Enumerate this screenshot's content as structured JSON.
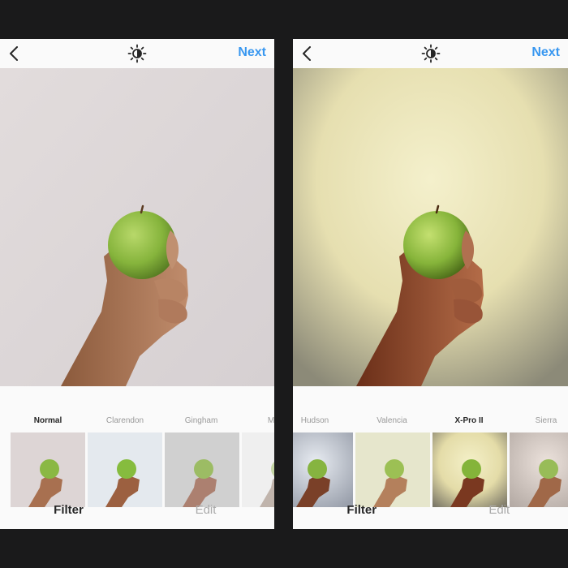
{
  "screens": [
    {
      "id": "left",
      "header": {
        "next_label": "Next",
        "back_icon": "chevron-left-icon",
        "adjust_icon": "lux-sun-icon"
      },
      "photo_filter": "Normal",
      "filters": [
        {
          "label": "Normal",
          "selected": true
        },
        {
          "label": "Clarendon",
          "selected": false
        },
        {
          "label": "Gingham",
          "selected": false
        },
        {
          "label": "M",
          "selected": false
        }
      ],
      "tabs": [
        {
          "label": "Filter",
          "active": true
        },
        {
          "label": "Edit",
          "active": false
        }
      ]
    },
    {
      "id": "right",
      "header": {
        "next_label": "Next",
        "back_icon": "chevron-left-icon",
        "adjust_icon": "lux-sun-icon"
      },
      "photo_filter": "X-Pro II",
      "filters": [
        {
          "label": "Hudson",
          "selected": false
        },
        {
          "label": "Valencia",
          "selected": false
        },
        {
          "label": "X-Pro II",
          "selected": true
        },
        {
          "label": "Sierra",
          "selected": false
        }
      ],
      "tabs": [
        {
          "label": "Filter",
          "active": true
        },
        {
          "label": "Edit",
          "active": false
        }
      ]
    }
  ],
  "colors": {
    "accent": "#3897f0",
    "background": "#fafafa",
    "frame": "#1a1a1b"
  }
}
